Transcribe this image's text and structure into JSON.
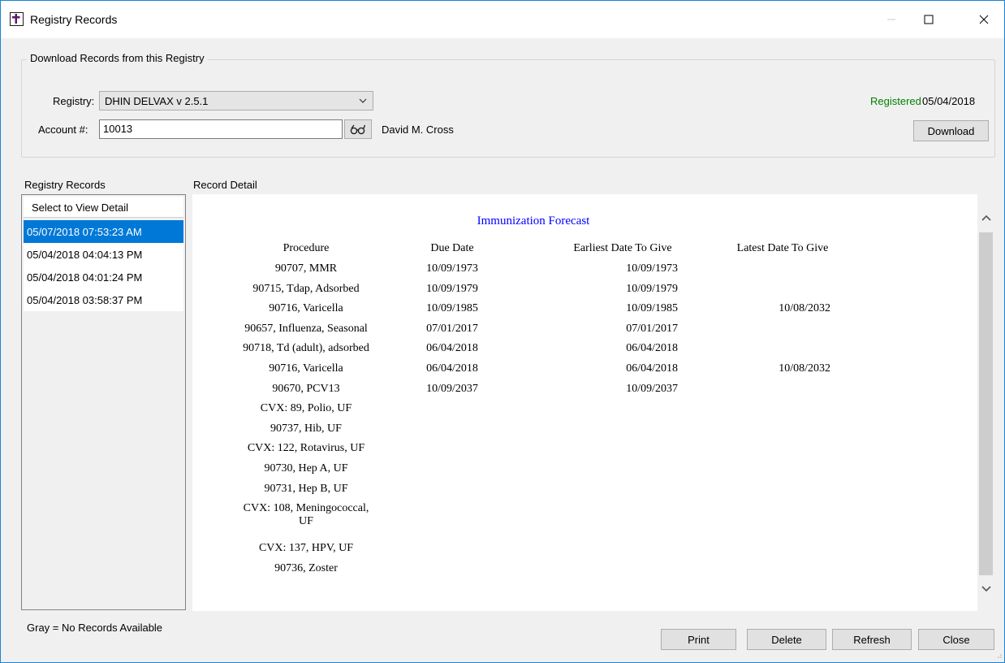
{
  "window": {
    "title": "Registry Records",
    "icons": {
      "app": "cross-document-icon",
      "minimize": "minimize-icon",
      "maximize": "maximize-icon",
      "close": "close-icon"
    }
  },
  "download_group": {
    "legend": "Download Records from this Registry",
    "registry_label": "Registry:",
    "registry_value": "DHIN DELVAX v 2.5.1",
    "account_label": "Account #:",
    "account_value": "10013",
    "patient_name": "David M. Cross",
    "registered_label": "Registered",
    "registered_date": "05/04/2018",
    "download_button": "Download",
    "lookup_icon": "binoculars-icon"
  },
  "records": {
    "title": "Registry Records",
    "header": "Select to View Detail",
    "items": [
      "05/07/2018  07:53:23 AM",
      "05/04/2018  04:04:13 PM",
      "05/04/2018  04:01:24 PM",
      "05/04/2018  03:58:37 PM"
    ],
    "selected_index": 0
  },
  "detail": {
    "title": "Record Detail",
    "forecast_title": "Immunization Forecast",
    "columns": [
      "Procedure",
      "Due Date",
      "Earliest Date To Give",
      "Latest Date To Give"
    ],
    "rows": [
      [
        "90707, MMR",
        "10/09/1973",
        "10/09/1973",
        ""
      ],
      [
        "90715, Tdap, Adsorbed",
        "10/09/1979",
        "10/09/1979",
        ""
      ],
      [
        "90716, Varicella",
        "10/09/1985",
        "10/09/1985",
        "10/08/2032"
      ],
      [
        "90657, Influenza, Seasonal",
        "07/01/2017",
        "07/01/2017",
        ""
      ],
      [
        "90718, Td (adult), adsorbed",
        "06/04/2018",
        "06/04/2018",
        ""
      ],
      [
        "90716, Varicella",
        "06/04/2018",
        "06/04/2018",
        "10/08/2032"
      ],
      [
        "90670, PCV13",
        "10/09/2037",
        "10/09/2037",
        ""
      ],
      [
        "CVX: 89, Polio, UF",
        "",
        "",
        ""
      ],
      [
        "90737, Hib, UF",
        "",
        "",
        ""
      ],
      [
        "CVX: 122, Rotavirus, UF",
        "",
        "",
        ""
      ],
      [
        "90730, Hep A, UF",
        "",
        "",
        ""
      ],
      [
        "90731, Hep B, UF",
        "",
        "",
        ""
      ],
      [
        "CVX: 108, Meningococcal,|UF",
        "",
        "",
        ""
      ],
      [
        "CVX: 137, HPV, UF",
        "",
        "",
        ""
      ],
      [
        "90736, Zoster",
        "",
        "",
        ""
      ]
    ],
    "scroll_icons": {
      "up": "chevron-up-icon",
      "down": "chevron-down-icon"
    }
  },
  "footer": {
    "legend_note": "Gray = No Records Available",
    "buttons": {
      "print": "Print",
      "delete": "Delete",
      "refresh": "Refresh",
      "close": "Close"
    }
  }
}
